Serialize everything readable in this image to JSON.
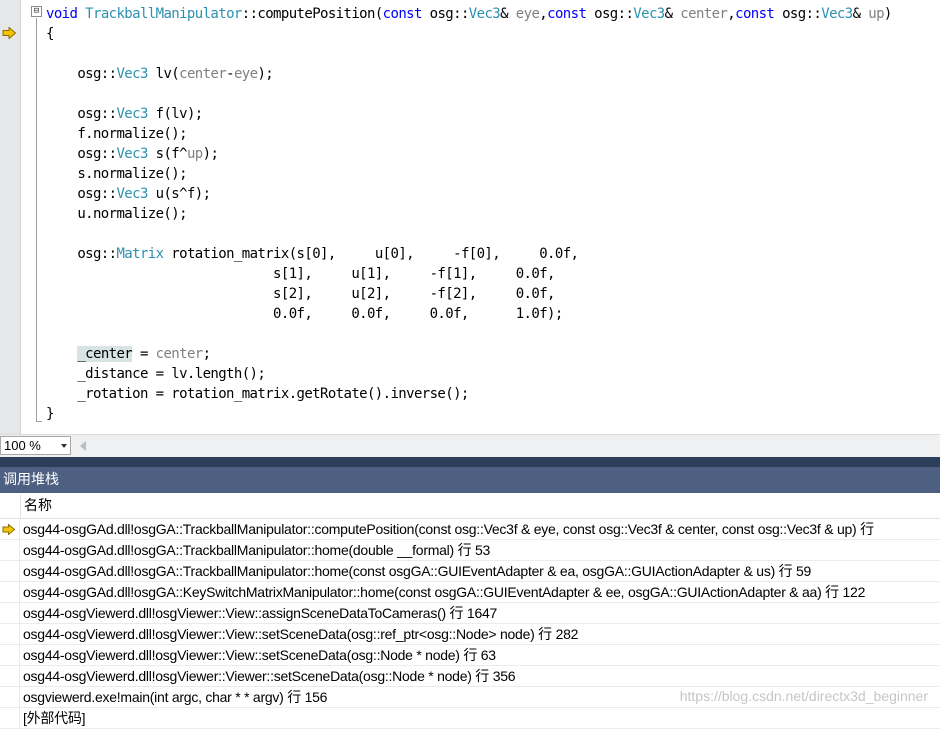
{
  "editor": {
    "lines": [
      [
        [
          "kw",
          "void "
        ],
        [
          "ty",
          "TrackballManipulator"
        ],
        [
          "mb",
          "::computePosition("
        ],
        [
          "kw",
          "const "
        ],
        [
          "mb",
          "osg::"
        ],
        [
          "ty",
          "Vec3"
        ],
        [
          "mb",
          "& "
        ],
        [
          "pr",
          "eye"
        ],
        [
          "mb",
          ","
        ],
        [
          "kw",
          "const "
        ],
        [
          "mb",
          "osg::"
        ],
        [
          "ty",
          "Vec3"
        ],
        [
          "mb",
          "& "
        ],
        [
          "pr",
          "center"
        ],
        [
          "mb",
          ","
        ],
        [
          "kw",
          "const "
        ],
        [
          "mb",
          "osg::"
        ],
        [
          "ty",
          "Vec3"
        ],
        [
          "mb",
          "& "
        ],
        [
          "pr",
          "up"
        ],
        [
          "mb",
          ")"
        ]
      ],
      [
        [
          "mb",
          "{"
        ]
      ],
      [],
      [
        [
          "mb",
          "    osg::"
        ],
        [
          "ty",
          "Vec3"
        ],
        [
          "mb",
          " lv("
        ],
        [
          "pr",
          "center"
        ],
        [
          "mb",
          "-"
        ],
        [
          "pr",
          "eye"
        ],
        [
          "mb",
          ");"
        ]
      ],
      [],
      [
        [
          "mb",
          "    osg::"
        ],
        [
          "ty",
          "Vec3"
        ],
        [
          "mb",
          " f(lv);"
        ]
      ],
      [
        [
          "mb",
          "    f.normalize();"
        ]
      ],
      [
        [
          "mb",
          "    osg::"
        ],
        [
          "ty",
          "Vec3"
        ],
        [
          "mb",
          " s(f^"
        ],
        [
          "pr",
          "up"
        ],
        [
          "mb",
          ");"
        ]
      ],
      [
        [
          "mb",
          "    s.normalize();"
        ]
      ],
      [
        [
          "mb",
          "    osg::"
        ],
        [
          "ty",
          "Vec3"
        ],
        [
          "mb",
          " u(s^f);"
        ]
      ],
      [
        [
          "mb",
          "    u.normalize();"
        ]
      ],
      [],
      [
        [
          "mb",
          "    osg::"
        ],
        [
          "ty",
          "Matrix"
        ],
        [
          "mb",
          " rotation_matrix(s[0],     u[0],     -f[0],     0.0f,"
        ]
      ],
      [
        [
          "mb",
          "                             s[1],     u[1],     -f[1],     0.0f,"
        ]
      ],
      [
        [
          "mb",
          "                             s[2],     u[2],     -f[2],     0.0f,"
        ]
      ],
      [
        [
          "mb",
          "                             0.0f,     0.0f,     0.0f,      1.0f);"
        ]
      ],
      [],
      [
        [
          "mb",
          "    "
        ],
        [
          "hl",
          "_center"
        ],
        [
          "mb",
          " = "
        ],
        [
          "pr",
          "center"
        ],
        [
          "mb",
          ";"
        ]
      ],
      [
        [
          "mb",
          "    _distance = lv.length();"
        ]
      ],
      [
        [
          "mb",
          "    _rotation = rotation_matrix.getRotate().inverse();"
        ]
      ],
      [
        [
          "mb",
          "}"
        ]
      ]
    ],
    "outline_toggle": "⊟",
    "colors": {
      "keyword": "#0000ff",
      "type": "#2b91af",
      "param": "#808080",
      "exec_arrow": "#f5c400"
    }
  },
  "zoom": {
    "value": "100 %"
  },
  "call_stack": {
    "title": "调用堆栈",
    "column_name": "名称",
    "rows": [
      "osg44-osgGAd.dll!osgGA::TrackballManipulator::computePosition(const osg::Vec3f & eye, const osg::Vec3f & center, const osg::Vec3f & up) 行",
      "osg44-osgGAd.dll!osgGA::TrackballManipulator::home(double __formal) 行 53",
      "osg44-osgGAd.dll!osgGA::TrackballManipulator::home(const osgGA::GUIEventAdapter & ea, osgGA::GUIActionAdapter & us) 行 59",
      "osg44-osgGAd.dll!osgGA::KeySwitchMatrixManipulator::home(const osgGA::GUIEventAdapter & ee, osgGA::GUIActionAdapter & aa) 行 122",
      "osg44-osgViewerd.dll!osgViewer::View::assignSceneDataToCameras() 行 1647",
      "osg44-osgViewerd.dll!osgViewer::View::setSceneData(osg::ref_ptr<osg::Node> node) 行 282",
      "osg44-osgViewerd.dll!osgViewer::View::setSceneData(osg::Node * node) 行 63",
      "osg44-osgViewerd.dll!osgViewer::Viewer::setSceneData(osg::Node * node) 行 356",
      "osgviewerd.exe!main(int argc, char * * argv) 行 156",
      "[外部代码]"
    ],
    "watermark": "https://blog.csdn.net/directx3d_beginner"
  }
}
